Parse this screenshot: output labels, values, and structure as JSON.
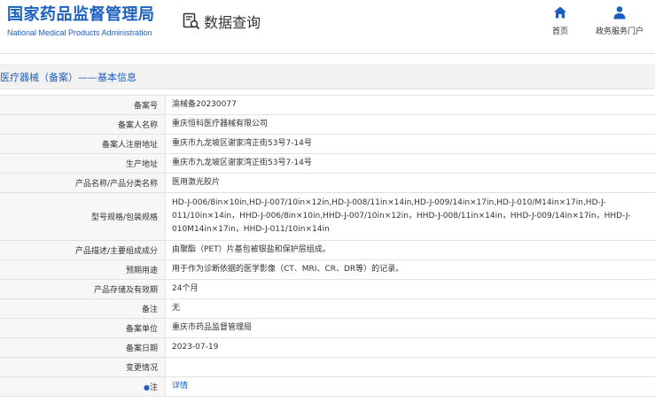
{
  "header": {
    "brand_cn": "国家药品监督管理局",
    "brand_en": "National Medical Products Administration",
    "module_title": "数据查询",
    "module_icon": "data-query-icon",
    "nav": [
      {
        "label": "首页",
        "icon": "home-icon"
      },
      {
        "label": "政务服务门户",
        "icon": "user-icon"
      }
    ]
  },
  "section": {
    "title": "医疗器械（备案）——基本信息"
  },
  "colors": {
    "brand_blue": "#1b5fbf",
    "section_bg": "#f2f2f2",
    "label_bg": "#f7f7f7",
    "border": "#e3e3e3"
  },
  "rows": [
    {
      "label": "备案号",
      "value": "渝械备20230077"
    },
    {
      "label": "备案人名称",
      "value": "重庆恒科医疗器械有限公司"
    },
    {
      "label": "备案人注册地址",
      "value": "重庆市九龙坡区谢家湾正街53号7-14号"
    },
    {
      "label": "生产地址",
      "value": "重庆市九龙坡区谢家湾正街53号7-14号"
    },
    {
      "label": "产品名称/产品分类名称",
      "value": "医用激光胶片"
    },
    {
      "label": "型号规格/包装规格",
      "value": "HD-J-006/8in×10in,HD-J-007/10in×12in,HD-J-008/11in×14in,HD-J-009/14in×17in,HD-J-010/M14in×17in,HD-J-011/10in×14in，HHD-J-006/8in×10in,HHD-J-007/10in×12in，HHD-J-008/11in×14in，HHD-J-009/14in×17in，HHD-J-010M14in×17in，HHD-J-011/10in×14in"
    },
    {
      "label": "产品描述/主要组成成分",
      "value": "由聚酯（PET）片基包被银盐和保护层组成。"
    },
    {
      "label": "预期用途",
      "value": "用于作为诊断依据的医学影像（CT、MRI、CR、DR等）的记录。"
    },
    {
      "label": "产品存储及有效期",
      "value": "24个月"
    },
    {
      "label": "备注",
      "value": "无"
    },
    {
      "label": "备案单位",
      "value": "重庆市药品监督管理局"
    },
    {
      "label": "备案日期",
      "value": "2023-07-19"
    },
    {
      "label": "变更情况",
      "value": ""
    }
  ],
  "detail_row": {
    "help_icon": "help-icon",
    "label": "注",
    "link_label": "详情"
  }
}
